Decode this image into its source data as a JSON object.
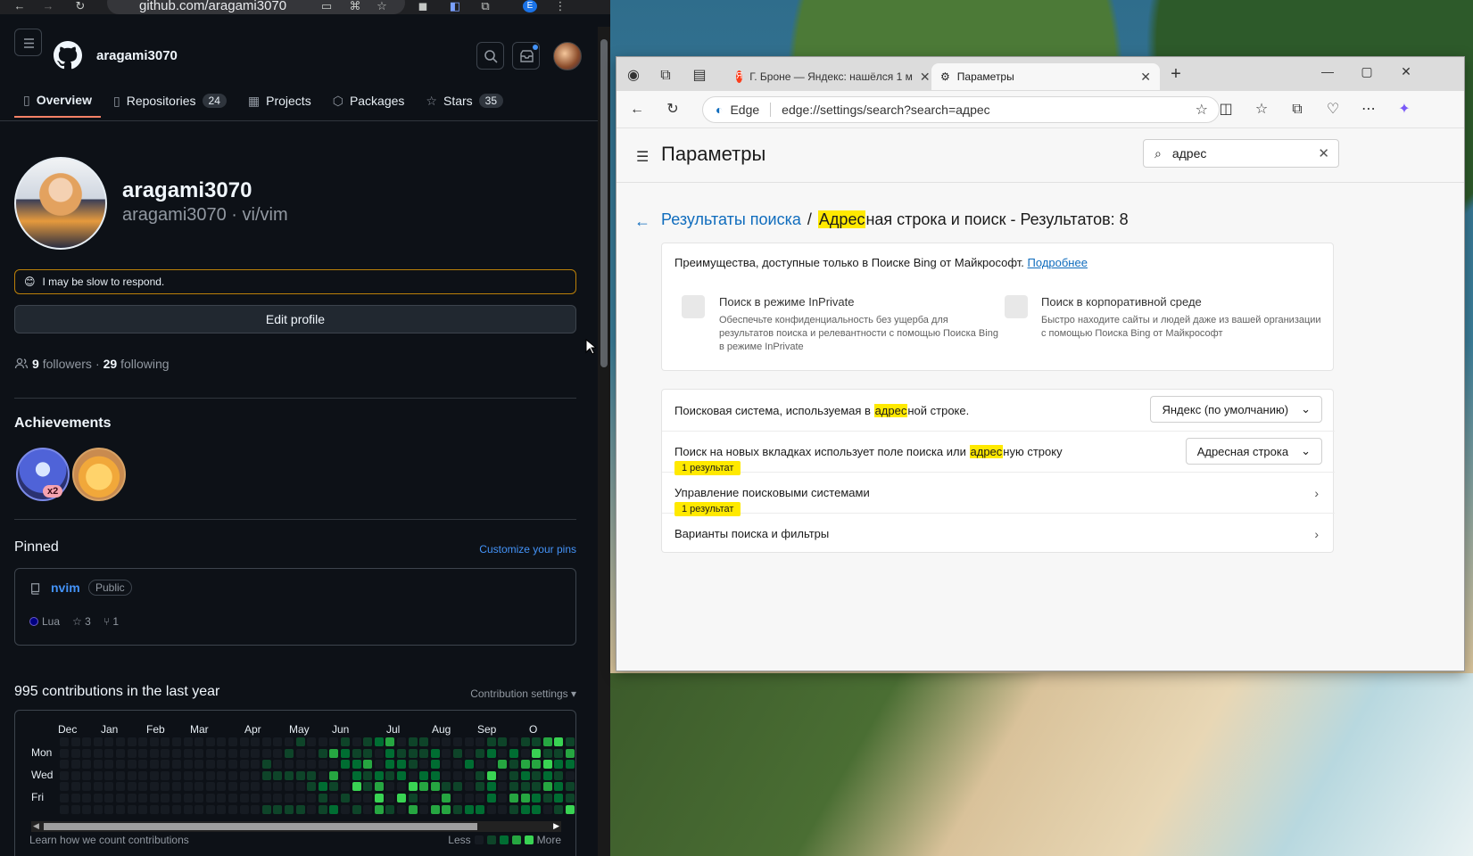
{
  "github": {
    "url": "github.com/aragami3070",
    "username": "aragami3070",
    "tabs": [
      {
        "label": "Overview",
        "count": ""
      },
      {
        "label": "Repositories",
        "count": "24"
      },
      {
        "label": "Projects",
        "count": ""
      },
      {
        "label": "Packages",
        "count": ""
      },
      {
        "label": "Stars",
        "count": "35"
      }
    ],
    "display_name": "aragami3070",
    "login_and_pronouns": "aragami3070 · vi/vim",
    "status_emoji": "😊",
    "status_text": "I may be slow to respond.",
    "edit_profile": "Edit profile",
    "followers_count": "9",
    "followers_label": "followers",
    "following_count": "29",
    "following_label": "following",
    "dot": "·",
    "achievements_title": "Achievements",
    "achievement_multiplier": "x2",
    "pinned_title": "Pinned",
    "customize_pins": "Customize your pins",
    "pinned_repo": {
      "name": "nvim",
      "visibility": "Public",
      "language": "Lua",
      "stars": "3",
      "forks": "1"
    },
    "contributions_title": "995 contributions in the last year",
    "contribution_settings": "Contribution settings",
    "months": [
      "Dec",
      "Jan",
      "Feb",
      "Mar",
      "Apr",
      "May",
      "Jun",
      "Jul",
      "Aug",
      "Sep",
      "O"
    ],
    "days": [
      "Mon",
      "Wed",
      "Fri"
    ],
    "learn_link": "Learn how we count contributions",
    "less": "Less",
    "more": "More",
    "level_colors": [
      "#161b22",
      "#0e4429",
      "#006d32",
      "#26a641",
      "#39d353"
    ]
  },
  "edge": {
    "tab_inactive": "Г. Броне — Яндекс: нашёлся 1 м",
    "tab_active": "Параметры",
    "address_site": "Edge",
    "address_url": "edge://settings/search?search=адрес",
    "page_title": "Параметры",
    "search_value": "адрес",
    "crumb_link": "Результаты поиска",
    "crumb_sep": "/",
    "crumb_highlight": "Адрес",
    "crumb_rest": "ная строка и поиск - Результатов: 8",
    "bing_text": "Преимущества, доступные только в Поиске Bing от Майкрософт.",
    "bing_link": "Подробнее",
    "feature1_title": "Поиск в режиме InPrivate",
    "feature1_desc": "Обеспечьте конфиденциальность без ущерба для результатов поиска и релевантности с помощью Поиска Bing в режиме InPrivate",
    "feature2_title": "Поиск в корпоративной среде",
    "feature2_desc": "Быстро находите сайты и людей даже из вашей организации с помощью Поиска Bing от Майкрософт",
    "row1_pre": "Поисковая система, используемая в ",
    "row1_hl": "адрес",
    "row1_post": "ной строке.",
    "row1_value": "Яндекс (по умолчанию)",
    "row2_pre": "Поиск на новых вкладках использует поле поиска или ",
    "row2_hl": "адрес",
    "row2_post": "ную строку",
    "row2_value": "Адресная строка",
    "badge": "1 результат",
    "row3": "Управление поисковыми системами",
    "row4": "Варианты поиска и фильтры"
  }
}
